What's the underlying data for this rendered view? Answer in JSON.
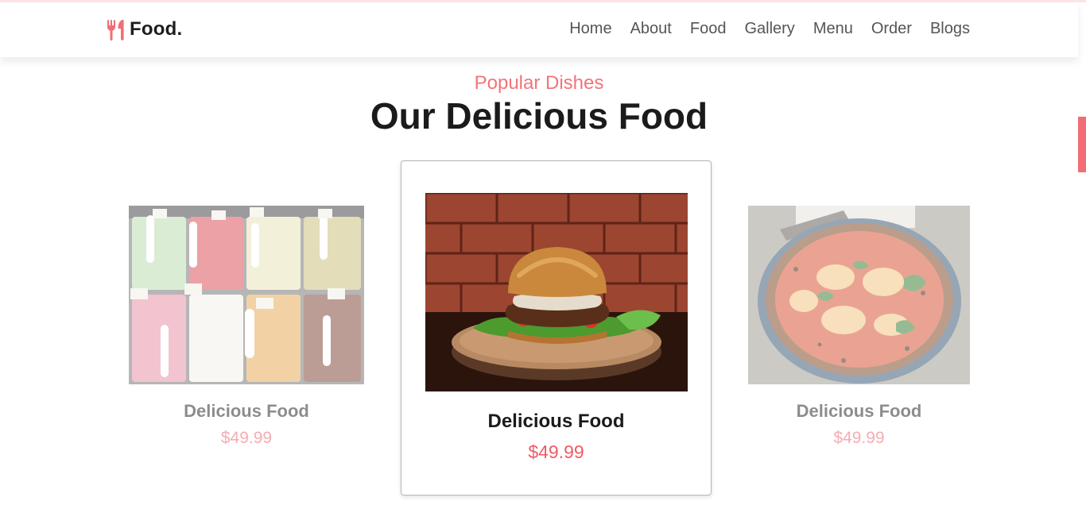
{
  "brand": {
    "name": "Food.",
    "icon": "fork-knife-icon",
    "accent": "#f26d74"
  },
  "nav": {
    "items": [
      {
        "label": "Home"
      },
      {
        "label": "About"
      },
      {
        "label": "Food"
      },
      {
        "label": "Gallery"
      },
      {
        "label": "Menu"
      },
      {
        "label": "Order"
      },
      {
        "label": "Blogs"
      }
    ]
  },
  "section": {
    "subtitle": "Popular Dishes",
    "title": "Our Delicious Food"
  },
  "dishes": [
    {
      "image": "ice-cream-image",
      "name": "Delicious Food",
      "price": "$49.99",
      "active": false
    },
    {
      "image": "burger-image",
      "name": "Delicious Food",
      "price": "$49.99",
      "active": true
    },
    {
      "image": "pizza-image",
      "name": "Delicious Food",
      "price": "$49.99",
      "active": false
    }
  ]
}
